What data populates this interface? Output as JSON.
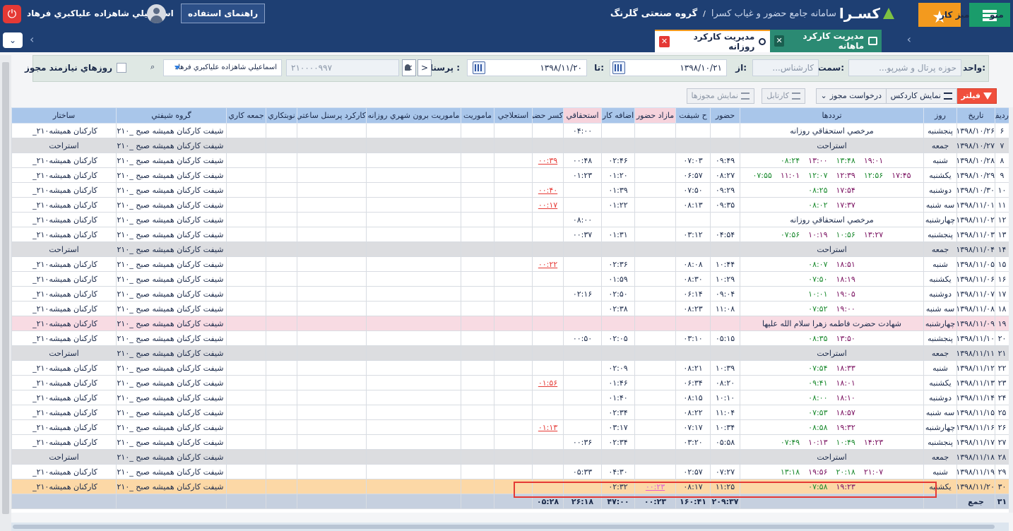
{
  "topbar": {
    "logo_text": "کسـرا",
    "system_title": "سامانه جامع حضور و غیاب کسرا",
    "separator": "/",
    "company": "گروه صنعتی گلرنگ",
    "user_name": "اسماعيلي شاهزاده علياكبري فرهاد",
    "help_label": "راهنمای استفاده",
    "menu_label": "منو",
    "desk_label": "میز کار",
    "accent_green": "#1a9c6b",
    "accent_orange": "#f39a1e",
    "header_blue": "#1e3f73"
  },
  "tabs": {
    "monthly": "مدیریت کارکرد ماهانه",
    "daily": "مدیریت کارکرد روزانه",
    "close": "✕"
  },
  "filters": {
    "unit_label": "واحد:",
    "unit_value": "حوزه پرتال و شيرپو...",
    "post_label": "سمت:",
    "post_value": "کارشناس...",
    "from_label": "از:",
    "from_value": "۱۳۹۸/۱۰/۲۱",
    "to_label": "تا:",
    "to_value": "۱۳۹۸/۱۱/۲۰",
    "personnel_label": "پرسنلي :",
    "personnel_code": "۲۱۰۰۰۰۹۹۷",
    "personnel_name": "اسماعيلي شاهزاده علياكبري فرهاد",
    "prev": "<",
    "next": ">",
    "permit_days_label": "روزهاي نيازمند مجوز"
  },
  "toolbar": {
    "filter": "فيلتر",
    "show_cardex": "نمايش کاردکس",
    "request_permit": "درخواست مجوز",
    "cardtabl": "کارتابل",
    "show_permits": "نمايش مجوزها"
  },
  "columns": [
    "رديف",
    "تاريخ",
    "روز",
    "ترددها",
    "حضور",
    "ح شیفت",
    "مازاد حضور",
    "اضافه کار",
    "استحقاقي",
    "کسر حضور",
    "استعلاجي",
    "ماموريت",
    "ماموريت برون شهري روزانه",
    "کارکرد پرسنل ساعتي",
    "نوبتکاري",
    "جمعه کاري",
    "گروه شيفتي",
    "ساختار"
  ],
  "rows": [
    {
      "type": "normal",
      "n": "۶",
      "date": "۱۳۹۸/۱۰/۲۶",
      "day": "پنجشنبه",
      "note": "مرخصي استحقاقي روزانه",
      "p": "",
      "sh": "",
      "ex": "",
      "ot": "",
      "ent": "۰۴:۰۰",
      "def": "",
      "shift": "شيفت کارکنان هميشه صبح _۲۱۰",
      "struct": "_۲۱۰کارکنان هميشه"
    },
    {
      "type": "rest",
      "n": "۷",
      "date": "۱۳۹۸/۱۰/۲۷",
      "day": "جمعه",
      "note": "استراحت",
      "p": "",
      "sh": "",
      "ex": "",
      "ot": "",
      "ent": "",
      "def": "",
      "shift": "شيفت کارکنان هميشه صبح _۲۱۰",
      "struct": "استراحت"
    },
    {
      "type": "normal",
      "n": "۸",
      "date": "۱۳۹۸/۱۰/۲۸",
      "day": "شنبه",
      "t": [
        "۰۸:۲۴",
        "۱۳:۰۰",
        "۱۳:۴۸",
        "۱۹:۰۱"
      ],
      "p": "۰۹:۴۹",
      "sh": "۰۷:۰۳",
      "ex": "",
      "ot": "۰۲:۴۶",
      "ent": "۰۰:۴۸",
      "def": "۰۰:۳۹",
      "shift": "شيفت کارکنان هميشه صبح _۲۱۰",
      "struct": "_۲۱۰کارکنان هميشه"
    },
    {
      "type": "normal",
      "n": "۹",
      "date": "۱۳۹۸/۱۰/۲۹",
      "day": "يکشنبه",
      "t": [
        "۰۷:۵۵",
        "۱۱:۰۱",
        "۱۲:۰۷",
        "۱۲:۳۹",
        "۱۲:۵۶",
        "۱۷:۴۵"
      ],
      "p": "۰۸:۲۷",
      "sh": "۰۶:۵۷",
      "ex": "",
      "ot": "۰۱:۲۰",
      "ent": "۰۱:۲۳",
      "def": "",
      "shift": "شيفت کارکنان هميشه صبح _۲۱۰",
      "struct": "_۲۱۰کارکنان هميشه"
    },
    {
      "type": "normal",
      "n": "۱۰",
      "date": "۱۳۹۸/۱۰/۳۰",
      "day": "دوشنبه",
      "t": [
        "۰۸:۲۵",
        "۱۷:۵۴"
      ],
      "p": "۰۹:۲۹",
      "sh": "۰۷:۵۰",
      "ex": "",
      "ot": "۰۱:۳۹",
      "ent": "",
      "def": "۰۰:۴۰",
      "shift": "شيفت کارکنان هميشه صبح _۲۱۰",
      "struct": "_۲۱۰کارکنان هميشه"
    },
    {
      "type": "normal",
      "n": "۱۱",
      "date": "۱۳۹۸/۱۱/۰۱",
      "day": "سه شنبه",
      "t": [
        "۰۸:۰۲",
        "۱۷:۳۷"
      ],
      "p": "۰۹:۳۵",
      "sh": "۰۸:۱۳",
      "ex": "",
      "ot": "۰۱:۲۲",
      "ent": "",
      "def": "۰۰:۱۷",
      "shift": "شيفت کارکنان هميشه صبح _۲۱۰",
      "struct": "_۲۱۰کارکنان هميشه"
    },
    {
      "type": "normal",
      "n": "۱۲",
      "date": "۱۳۹۸/۱۱/۰۲",
      "day": "چهارشنبه",
      "note": "مرخصي استحقاقي روزانه",
      "p": "",
      "sh": "",
      "ex": "",
      "ot": "",
      "ent": "۰۸:۰۰",
      "def": "",
      "shift": "شيفت کارکنان هميشه صبح _۲۱۰",
      "struct": "_۲۱۰کارکنان هميشه"
    },
    {
      "type": "normal",
      "n": "۱۳",
      "date": "۱۳۹۸/۱۱/۰۳",
      "day": "پنجشنبه",
      "t": [
        "۰۷:۵۶",
        "۱۰:۱۹",
        "۱۰:۵۶",
        "۱۳:۲۷"
      ],
      "p": "۰۴:۵۴",
      "sh": "۰۳:۱۲",
      "ex": "",
      "ot": "۰۱:۳۱",
      "ent": "۰۰:۳۷",
      "def": "",
      "shift": "شيفت کارکنان هميشه صبح _۲۱۰",
      "struct": "_۲۱۰کارکنان هميشه"
    },
    {
      "type": "rest",
      "n": "۱۴",
      "date": "۱۳۹۸/۱۱/۰۴",
      "day": "جمعه",
      "note": "استراحت",
      "p": "",
      "sh": "",
      "ex": "",
      "ot": "",
      "ent": "",
      "def": "",
      "shift": "شيفت کارکنان هميشه صبح _۲۱۰",
      "struct": "استراحت"
    },
    {
      "type": "normal",
      "n": "۱۵",
      "date": "۱۳۹۸/۱۱/۰۵",
      "day": "شنبه",
      "t": [
        "۰۸:۰۷",
        "۱۸:۵۱"
      ],
      "p": "۱۰:۴۴",
      "sh": "۰۸:۰۸",
      "ex": "",
      "ot": "۰۲:۳۶",
      "ent": "",
      "def": "۰۰:۲۲",
      "shift": "شيفت کارکنان هميشه صبح _۲۱۰",
      "struct": "_۲۱۰کارکنان هميشه"
    },
    {
      "type": "normal",
      "n": "۱۶",
      "date": "۱۳۹۸/۱۱/۰۶",
      "day": "يکشنبه",
      "t": [
        "۰۷:۵۰",
        "۱۸:۱۹"
      ],
      "p": "۱۰:۲۹",
      "sh": "۰۸:۳۰",
      "ex": "",
      "ot": "۰۱:۵۹",
      "ent": "",
      "def": "",
      "shift": "شيفت کارکنان هميشه صبح _۲۱۰",
      "struct": "_۲۱۰کارکنان هميشه"
    },
    {
      "type": "normal",
      "n": "۱۷",
      "date": "۱۳۹۸/۱۱/۰۷",
      "day": "دوشنبه",
      "t": [
        "۱۰:۰۱",
        "۱۹:۰۵"
      ],
      "p": "۰۹:۰۴",
      "sh": "۰۶:۱۴",
      "ex": "",
      "ot": "۰۲:۵۰",
      "ent": "۰۲:۱۶",
      "def": "",
      "shift": "شيفت کارکنان هميشه صبح _۲۱۰",
      "struct": "_۲۱۰کارکنان هميشه"
    },
    {
      "type": "normal",
      "n": "۱۸",
      "date": "۱۳۹۸/۱۱/۰۸",
      "day": "سه شنبه",
      "t": [
        "۰۷:۵۲",
        "۱۹:۰۰"
      ],
      "p": "۱۱:۰۸",
      "sh": "۰۸:۲۳",
      "ex": "",
      "ot": "۰۲:۳۸",
      "ent": "",
      "def": "",
      "shift": "شيفت کارکنان هميشه صبح _۲۱۰",
      "struct": "_۲۱۰کارکنان هميشه"
    },
    {
      "type": "holiday",
      "n": "۱۹",
      "date": "۱۳۹۸/۱۱/۰۹",
      "day": "چهارشنبه",
      "note": "شهادت حضرت فاطمه زهرا سلام الله عليها",
      "p": "",
      "sh": "",
      "ex": "",
      "ot": "",
      "ent": "",
      "def": "",
      "shift": "شيفت کارکنان هميشه صبح _۲۱۰",
      "struct": "_۲۱۰کارکنان هميشه"
    },
    {
      "type": "normal",
      "n": "۲۰",
      "date": "۱۳۹۸/۱۱/۱۰",
      "day": "پنجشنبه",
      "t": [
        "۰۸:۳۵",
        "۱۳:۵۰"
      ],
      "p": "۰۵:۱۵",
      "sh": "۰۳:۱۰",
      "ex": "",
      "ot": "۰۲:۰۵",
      "ent": "۰۰:۵۰",
      "def": "",
      "shift": "شيفت کارکنان هميشه صبح _۲۱۰",
      "struct": "_۲۱۰کارکنان هميشه"
    },
    {
      "type": "rest",
      "n": "۲۱",
      "date": "۱۳۹۸/۱۱/۱۱",
      "day": "جمعه",
      "note": "استراحت",
      "p": "",
      "sh": "",
      "ex": "",
      "ot": "",
      "ent": "",
      "def": "",
      "shift": "شيفت کارکنان هميشه صبح _۲۱۰",
      "struct": "استراحت"
    },
    {
      "type": "normal",
      "n": "۲۲",
      "date": "۱۳۹۸/۱۱/۱۲",
      "day": "شنبه",
      "t": [
        "۰۷:۵۴",
        "۱۸:۳۳"
      ],
      "p": "۱۰:۳۹",
      "sh": "۰۸:۲۱",
      "ex": "",
      "ot": "۰۲:۰۹",
      "ent": "",
      "def": "",
      "shift": "شيفت کارکنان هميشه صبح _۲۱۰",
      "struct": "_۲۱۰کارکنان هميشه"
    },
    {
      "type": "normal",
      "n": "۲۳",
      "date": "۱۳۹۸/۱۱/۱۳",
      "day": "يکشنبه",
      "t": [
        "۰۹:۴۱",
        "۱۸:۰۱"
      ],
      "p": "۰۸:۲۰",
      "sh": "۰۶:۳۴",
      "ex": "",
      "ot": "۰۱:۴۶",
      "ent": "",
      "def": "۰۱:۵۶",
      "shift": "شيفت کارکنان هميشه صبح _۲۱۰",
      "struct": "_۲۱۰کارکنان هميشه"
    },
    {
      "type": "normal",
      "n": "۲۴",
      "date": "۱۳۹۸/۱۱/۱۴",
      "day": "دوشنبه",
      "t": [
        "۰۸:۰۰",
        "۱۸:۱۰"
      ],
      "p": "۱۰:۱۰",
      "sh": "۰۸:۱۵",
      "ex": "",
      "ot": "۰۱:۴۰",
      "ent": "",
      "def": "",
      "shift": "شيفت کارکنان هميشه صبح _۲۱۰",
      "struct": "_۲۱۰کارکنان هميشه"
    },
    {
      "type": "normal",
      "n": "۲۵",
      "date": "۱۳۹۸/۱۱/۱۵",
      "day": "سه شنبه",
      "t": [
        "۰۷:۵۳",
        "۱۸:۵۷"
      ],
      "p": "۱۱:۰۴",
      "sh": "۰۸:۲۲",
      "ex": "",
      "ot": "۰۲:۳۴",
      "ent": "",
      "def": "",
      "shift": "شيفت کارکنان هميشه صبح _۲۱۰",
      "struct": "_۲۱۰کارکنان هميشه"
    },
    {
      "type": "normal",
      "n": "۲۶",
      "date": "۱۳۹۸/۱۱/۱۶",
      "day": "چهارشنبه",
      "t": [
        "۰۸:۵۸",
        "۱۹:۳۲"
      ],
      "p": "۱۰:۳۴",
      "sh": "۰۷:۱۷",
      "ex": "",
      "ot": "۰۳:۱۷",
      "ent": "",
      "def": "۰۱:۱۳",
      "shift": "شيفت کارکنان هميشه صبح _۲۱۰",
      "struct": "_۲۱۰کارکنان هميشه"
    },
    {
      "type": "normal",
      "n": "۲۷",
      "date": "۱۳۹۸/۱۱/۱۷",
      "day": "پنجشنبه",
      "t": [
        "۰۷:۴۹",
        "۱۰:۱۳",
        "۱۰:۴۹",
        "۱۴:۲۳"
      ],
      "p": "۰۵:۵۸",
      "sh": "۰۳:۲۰",
      "ex": "",
      "ot": "۰۲:۳۴",
      "ent": "۰۰:۳۶",
      "def": "",
      "shift": "شيفت کارکنان هميشه صبح _۲۱۰",
      "struct": "_۲۱۰کارکنان هميشه"
    },
    {
      "type": "rest",
      "n": "۲۸",
      "date": "۱۳۹۸/۱۱/۱۸",
      "day": "جمعه",
      "note": "استراحت",
      "p": "",
      "sh": "",
      "ex": "",
      "ot": "",
      "ent": "",
      "def": "",
      "shift": "شيفت کارکنان هميشه صبح _۲۱۰",
      "struct": "استراحت"
    },
    {
      "type": "normal",
      "n": "۲۹",
      "date": "۱۳۹۸/۱۱/۱۹",
      "day": "شنبه",
      "t": [
        "۱۳:۱۸",
        "۱۹:۵۶",
        "۲۰:۱۸",
        "۲۱:۰۷"
      ],
      "p": "۰۷:۲۷",
      "sh": "۰۲:۵۷",
      "ex": "",
      "ot": "۰۴:۳۰",
      "ent": "۰۵:۳۳",
      "def": "",
      "shift": "شيفت کارکنان هميشه صبح _۲۱۰",
      "struct": "_۲۱۰کارکنان هميشه"
    },
    {
      "type": "sel",
      "n": "۳۰",
      "date": "۱۳۹۸/۱۱/۲۰",
      "day": "يکشنبه",
      "t": [
        "۰۷:۵۸",
        "۱۹:۲۳"
      ],
      "p": "۱۱:۲۵",
      "sh": "۰۸:۱۷",
      "ex": "۰۰:۲۳",
      "ot": "۰۲:۳۲",
      "ent": "",
      "def": "",
      "shift": "شيفت کارکنان هميشه صبح _۲۱۰",
      "struct": "_۲۱۰کارکنان هميشه"
    }
  ],
  "totals": {
    "n": "۳۱",
    "label": "جمع",
    "p": "۲۰۹:۳۷",
    "sh": "۱۶۰:۴۱",
    "ex": "۰۰:۲۳",
    "ot": "۴۷:۰۰",
    "ent": "۲۶:۱۸",
    "def": "۰۵:۲۸"
  }
}
